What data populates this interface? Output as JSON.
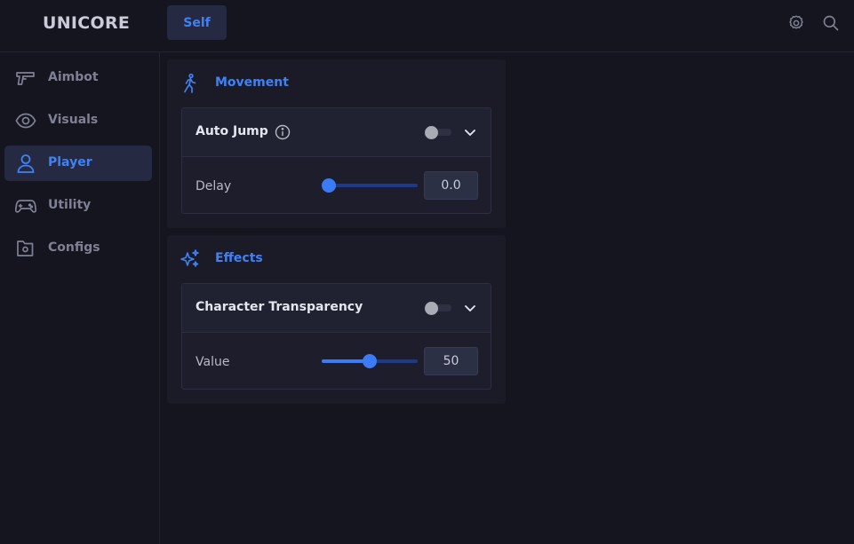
{
  "app": {
    "logo": "UNICORE"
  },
  "tabs": [
    {
      "label": "Self",
      "active": true
    }
  ],
  "header_icons": [
    "gear-icon",
    "search-icon"
  ],
  "sidebar": {
    "items": [
      {
        "label": "Aimbot",
        "icon": "gun-icon",
        "active": false
      },
      {
        "label": "Visuals",
        "icon": "eye-icon",
        "active": false
      },
      {
        "label": "Player",
        "icon": "user-icon",
        "active": true
      },
      {
        "label": "Utility",
        "icon": "gamepad-icon",
        "active": false
      },
      {
        "label": "Configs",
        "icon": "folder-icon",
        "active": false
      }
    ]
  },
  "sections": [
    {
      "title": "Movement",
      "icon": "walking-person-icon",
      "features": [
        {
          "title": "Auto Jump",
          "has_info": true,
          "enabled": false,
          "setting": {
            "label": "Delay",
            "value": "0.0",
            "level": 0.0
          }
        }
      ]
    },
    {
      "title": "Effects",
      "icon": "sparkles-icon",
      "features": [
        {
          "title": "Character Transparency",
          "has_info": false,
          "enabled": false,
          "setting": {
            "label": "Value",
            "value": "50",
            "level": 0.5
          }
        }
      ]
    }
  ],
  "colors": {
    "accent": "#3f82f6",
    "background": "#15151f",
    "panel": "#1b1b28",
    "active_bg": "#252941"
  }
}
